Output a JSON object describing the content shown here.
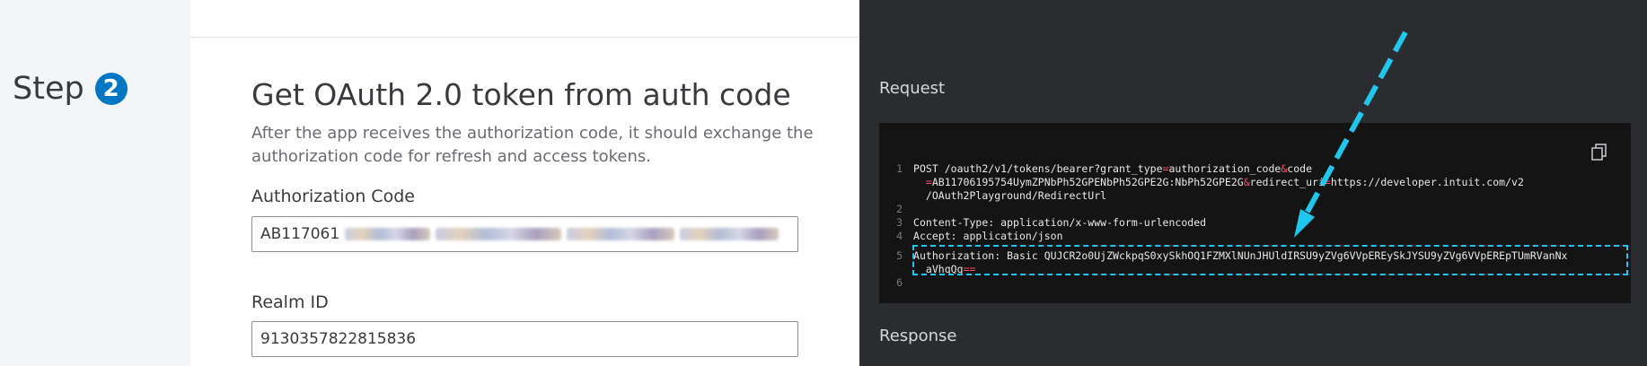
{
  "step": {
    "label": "Step",
    "number": "2"
  },
  "form": {
    "title": "Get OAuth 2.0 token from auth code",
    "description": "After the app receives the authorization code, it should exchange the authorization code for refresh and access tokens.",
    "auth_code": {
      "label": "Authorization Code",
      "value": "AB117061"
    },
    "realm_id": {
      "label": "Realm ID",
      "value": "9130357822815836"
    }
  },
  "request": {
    "label": "Request",
    "copy_icon": "copy-icon",
    "lines": [
      {
        "num": "1",
        "text": "POST /oauth2/v1/tokens/bearer?grant_type=authorization_code&code"
      },
      {
        "num": "",
        "text": "  =AB11706195754UymZPNbPh52GPENbPh52GPE2G:NbPh52GPE2G&redirect_uri=https://developer.intuit.com/v2"
      },
      {
        "num": "",
        "text": "  /OAuth2Playground/RedirectUrl"
      },
      {
        "num": "2",
        "text": ""
      },
      {
        "num": "3",
        "text": "Content-Type: application/x-www-form-urlencoded"
      },
      {
        "num": "4",
        "text": "Accept: application/json"
      },
      {
        "num": "5",
        "text": "Authorization: Basic QUJCR2o0UjZWckpqS0xySkhOQ1FZMXlNUnJHUldIRSU9yZVg6VVpEREySkJYSU9yZVg6VVpEREpTUmRVanNx"
      },
      {
        "num": "",
        "text": "  aVhqQg=="
      },
      {
        "num": "6",
        "text": ""
      }
    ]
  },
  "response": {
    "label": "Response"
  },
  "colors": {
    "accent": "#0077c5",
    "highlight": "#1cc8ee",
    "dark_bg": "#2b2c2f",
    "code_bg": "#141414"
  }
}
